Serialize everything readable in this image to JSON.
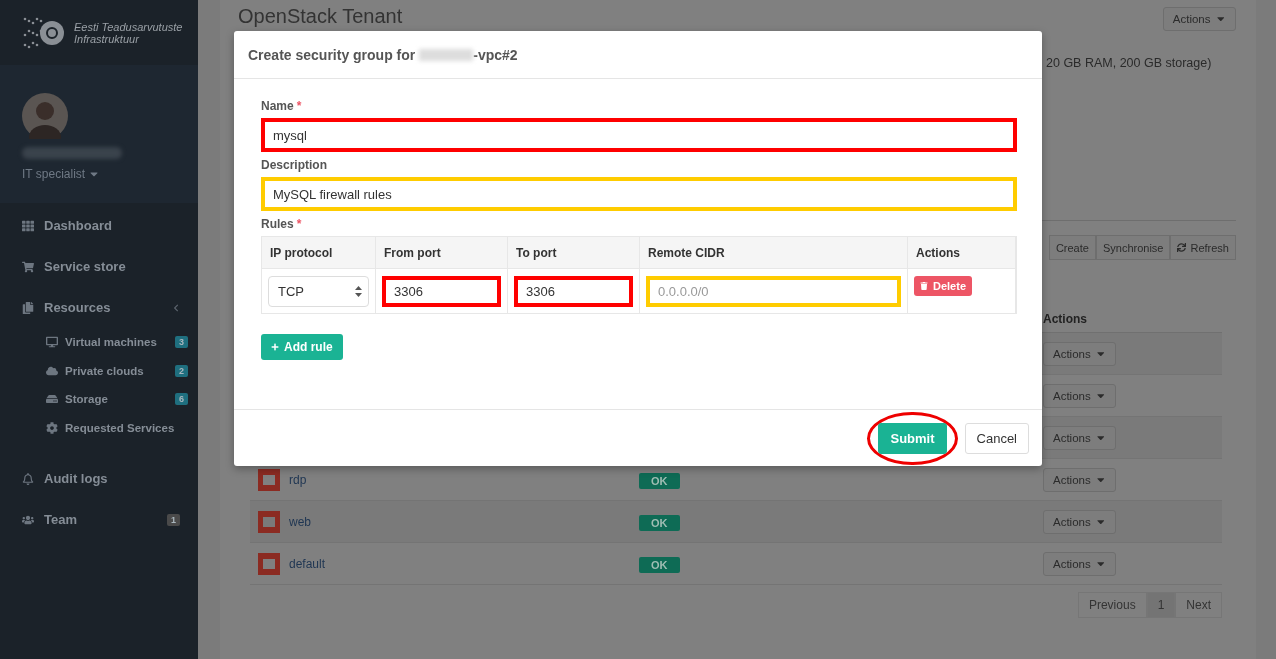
{
  "sidebar": {
    "logo_lines": [
      "Eesti Teadusarvutuste",
      "Infrastruktuur"
    ],
    "user": {
      "role": "IT specialist"
    },
    "nav": [
      {
        "label": "Dashboard"
      },
      {
        "label": "Service store"
      },
      {
        "label": "Resources",
        "children": [
          {
            "label": "Virtual machines",
            "badge": "3"
          },
          {
            "label": "Private clouds",
            "badge": "2"
          },
          {
            "label": "Storage",
            "badge": "6"
          },
          {
            "label": "Requested Services"
          }
        ]
      },
      {
        "label": "Audit logs"
      },
      {
        "label": "Team",
        "badge": "1"
      }
    ]
  },
  "page": {
    "title": "OpenStack Tenant",
    "header_action": "Actions",
    "summary": "20 GB RAM, 200 GB storage)",
    "toolbar": [
      "Create",
      "Synchronise",
      "Refresh"
    ],
    "table": {
      "columns": [
        "Actions"
      ],
      "rows": [
        {
          "action": "Actions"
        },
        {
          "action": "Actions"
        },
        {
          "action": "Actions"
        },
        {
          "name": "rdp",
          "status": "OK",
          "action": "Actions"
        },
        {
          "name": "web",
          "status": "OK",
          "action": "Actions"
        },
        {
          "name": "default",
          "status": "OK",
          "action": "Actions"
        }
      ]
    },
    "pagination": {
      "previous": "Previous",
      "pages": [
        {
          "label": "1",
          "selected": true
        }
      ],
      "next": "Next"
    }
  },
  "modal": {
    "title_prefix": "Create security group for",
    "title_suffix": "-vpc#2",
    "fields": [
      {
        "label": "Name",
        "required_mark": "*",
        "value": "mysql",
        "color": "#ff0000"
      },
      {
        "label": "Description",
        "value": "MySQL firewall rules",
        "color": "#ffcc00"
      }
    ],
    "rules": {
      "label": "Rules",
      "required_mark": "*",
      "columns": [
        "IP protocol",
        "From port",
        "To port",
        "Remote CIDR",
        "Actions"
      ],
      "rows": [
        {
          "protocol": "TCP",
          "from_port": {
            "value": "3306",
            "color": "#ff0000"
          },
          "to_port": {
            "value": "3306",
            "color": "#ff0000"
          },
          "cidr": {
            "placeholder": "0.0.0.0/0",
            "color": "#ffcc00"
          },
          "delete": "Delete"
        }
      ]
    },
    "add_rule": "Add rule",
    "buttons": [
      {
        "label": "Submit",
        "kind": "primary",
        "circled": true
      },
      {
        "label": "Cancel",
        "kind": "default",
        "circled": false
      }
    ]
  }
}
